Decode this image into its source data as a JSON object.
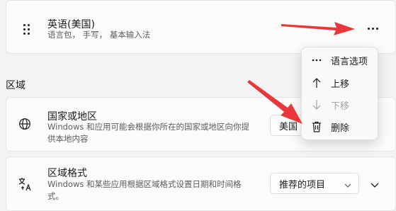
{
  "language_card": {
    "title": "英语(美国)",
    "subtitle": "语言包， 手写， 基本输入法"
  },
  "section": {
    "title": "区域"
  },
  "country_card": {
    "title": "国家或地区",
    "description_line1": "Windows 和应用可能会根据你所在的国家或地区向你提",
    "description_line2": "供本地内容",
    "selected_value": "美国"
  },
  "format_card": {
    "title": "区域格式",
    "description_line1": "Windows 和某些应用根据区域格式设置日期和时间格",
    "description_line2": "式。",
    "selected_value": "推荐的项目"
  },
  "context_menu": {
    "items": [
      {
        "label": "语言选项",
        "icon": "more-icon",
        "enabled": true
      },
      {
        "label": "上移",
        "icon": "arrow-up-icon",
        "enabled": true
      },
      {
        "label": "下移",
        "icon": "arrow-down-icon",
        "enabled": false
      },
      {
        "label": "删除",
        "icon": "trash-icon",
        "enabled": true
      }
    ]
  },
  "colors": {
    "background": "#f3f3f3",
    "card": "#fbfbfb",
    "annotation_arrow": "#e8383a"
  }
}
